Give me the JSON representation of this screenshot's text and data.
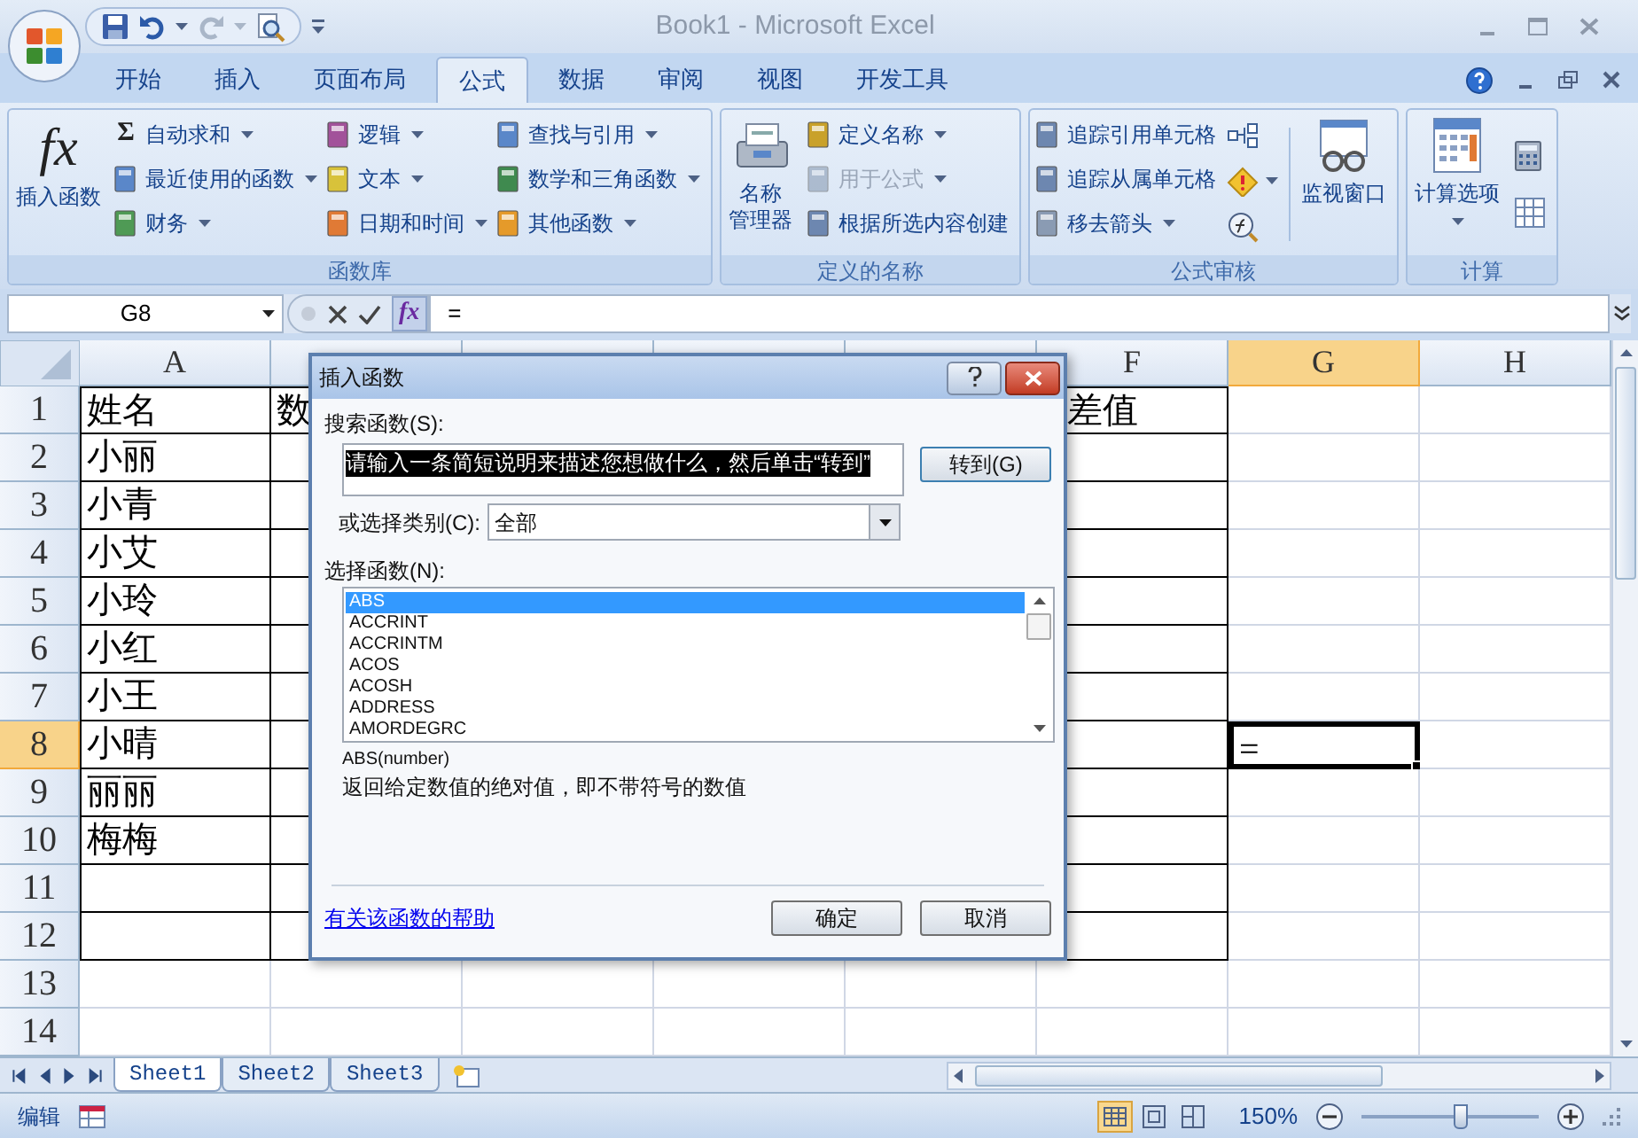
{
  "window": {
    "title": "Book1 - Microsoft Excel"
  },
  "tabs": [
    {
      "label": "开始",
      "selected": false
    },
    {
      "label": "插入",
      "selected": false
    },
    {
      "label": "页面布局",
      "selected": false
    },
    {
      "label": "公式",
      "selected": true
    },
    {
      "label": "数据",
      "selected": false
    },
    {
      "label": "审阅",
      "selected": false
    },
    {
      "label": "视图",
      "selected": false
    },
    {
      "label": "开发工具",
      "selected": false
    }
  ],
  "ribbon_groups": [
    {
      "title": "函数库",
      "columns": [
        [
          {
            "kind": "large",
            "label": "插入函数",
            "glyph": "fx",
            "dropdown": false
          }
        ],
        [
          {
            "kind": "small",
            "label": "自动求和",
            "glyph": "Σ",
            "dropdown": true,
            "disabled": false
          },
          {
            "kind": "small",
            "label": "最近使用的函数",
            "dropdown": true,
            "disabled": false
          },
          {
            "kind": "small",
            "label": "财务",
            "dropdown": true,
            "disabled": false
          }
        ],
        [
          {
            "kind": "small",
            "label": "逻辑",
            "dropdown": true,
            "disabled": false
          },
          {
            "kind": "small",
            "label": "文本",
            "dropdown": true,
            "disabled": false
          },
          {
            "kind": "small",
            "label": "日期和时间",
            "dropdown": true,
            "disabled": false
          }
        ],
        [
          {
            "kind": "small",
            "label": "查找与引用",
            "dropdown": true,
            "disabled": false
          },
          {
            "kind": "small",
            "label": "数学和三角函数",
            "dropdown": true,
            "disabled": false
          },
          {
            "kind": "small",
            "label": "其他函数",
            "dropdown": true,
            "disabled": false
          }
        ]
      ]
    },
    {
      "title": "定义的名称",
      "columns": [
        [
          {
            "kind": "large",
            "label": "名称管理器",
            "dropdown": false
          }
        ],
        [
          {
            "kind": "small",
            "label": "定义名称",
            "dropdown": true,
            "disabled": false
          },
          {
            "kind": "small",
            "label": "用于公式",
            "dropdown": true,
            "disabled": true
          },
          {
            "kind": "small",
            "label": "根据所选内容创建",
            "dropdown": false,
            "disabled": false
          }
        ]
      ]
    },
    {
      "title": "公式审核",
      "columns": [
        [
          {
            "kind": "small",
            "label": "追踪引用单元格",
            "dropdown": false,
            "disabled": false
          },
          {
            "kind": "small",
            "label": "追踪从属单元格",
            "dropdown": false,
            "disabled": false
          },
          {
            "kind": "small",
            "label": "移去箭头",
            "dropdown": true,
            "disabled": false
          }
        ],
        [
          {
            "kind": "icon",
            "dropdown": false
          },
          {
            "kind": "icon",
            "dropdown": true
          },
          {
            "kind": "icon",
            "dropdown": false
          }
        ],
        [
          {
            "kind": "large",
            "label": "监视窗口",
            "dropdown": false
          }
        ]
      ]
    },
    {
      "title": "计算",
      "columns": [
        [
          {
            "kind": "large",
            "label": "计算选项",
            "dropdown": true
          }
        ],
        [
          {
            "kind": "icon",
            "dropdown": false
          },
          {
            "kind": "icon",
            "dropdown": false
          }
        ]
      ]
    }
  ],
  "formula_bar": {
    "name_box": "G8",
    "function_button": "fx",
    "formula": "="
  },
  "columns": [
    {
      "label": "A",
      "selected": false
    },
    {
      "selected": false
    },
    {
      "selected": false
    },
    {
      "selected": false
    },
    {
      "selected": false
    },
    {
      "label": "F",
      "selected": false
    },
    {
      "label": "G",
      "selected": true
    },
    {
      "label": "H",
      "selected": false
    }
  ],
  "rows": [
    {
      "number": "1",
      "selected": false,
      "cells": [
        {
          "text": "姓名"
        },
        {
          "text": "数"
        },
        null,
        null,
        null,
        {
          "text": "差值"
        }
      ]
    },
    {
      "number": "2",
      "selected": false,
      "cells": [
        {
          "text": "小丽"
        }
      ]
    },
    {
      "number": "3",
      "selected": false,
      "cells": [
        {
          "text": "小青"
        }
      ]
    },
    {
      "number": "4",
      "selected": false,
      "cells": [
        {
          "text": "小艾"
        }
      ]
    },
    {
      "number": "5",
      "selected": false,
      "cells": [
        {
          "text": "小玲"
        }
      ]
    },
    {
      "number": "6",
      "selected": false,
      "cells": [
        {
          "text": "小红"
        }
      ]
    },
    {
      "number": "7",
      "selected": false,
      "cells": [
        {
          "text": "小王"
        }
      ]
    },
    {
      "number": "8",
      "selected": true,
      "cells": [
        {
          "text": "小晴"
        },
        null,
        null,
        null,
        null,
        null,
        {
          "text": "=",
          "active": true
        }
      ]
    },
    {
      "number": "9",
      "selected": false,
      "cells": [
        {
          "text": "丽丽"
        }
      ]
    },
    {
      "number": "10",
      "selected": false,
      "cells": [
        {
          "text": "梅梅"
        }
      ]
    },
    {
      "number": "11",
      "selected": false,
      "cells": []
    },
    {
      "number": "12",
      "selected": false,
      "cells": []
    },
    {
      "number": "13",
      "selected": false,
      "cells": []
    },
    {
      "number": "14",
      "selected": false,
      "cells": []
    }
  ],
  "dialog": {
    "title": "插入函数",
    "search_label": "搜索函数(S):",
    "search_value": "请输入一条简短说明来描述您想做什么，然后单击“转到”",
    "go_button": "转到(G)",
    "category_label": "或选择类别(C):",
    "category_value": "全部",
    "list_label": "选择函数(N):",
    "functions": [
      {
        "label": "ABS",
        "selected": true
      },
      {
        "label": "ACCRINT",
        "selected": false
      },
      {
        "label": "ACCRINTM",
        "selected": false
      },
      {
        "label": "ACOS",
        "selected": false
      },
      {
        "label": "ACOSH",
        "selected": false
      },
      {
        "label": "ADDRESS",
        "selected": false
      },
      {
        "label": "AMORDEGRC",
        "selected": false
      }
    ],
    "signature": "ABS(number)",
    "description": "返回给定数值的绝对值，即不带符号的数值",
    "help_link": "有关该函数的帮助",
    "ok_button": "确定",
    "cancel_button": "取消"
  },
  "sheets": [
    {
      "label": "Sheet1",
      "selected": true
    },
    {
      "label": "Sheet2",
      "selected": false
    },
    {
      "label": "Sheet3",
      "selected": false
    }
  ],
  "status_bar": {
    "mode": "编辑",
    "views": [
      {
        "selected": true
      },
      {
        "selected": false
      },
      {
        "selected": false
      }
    ],
    "zoom": "150%",
    "zoom_slider": {
      "level": 0.56
    }
  }
}
